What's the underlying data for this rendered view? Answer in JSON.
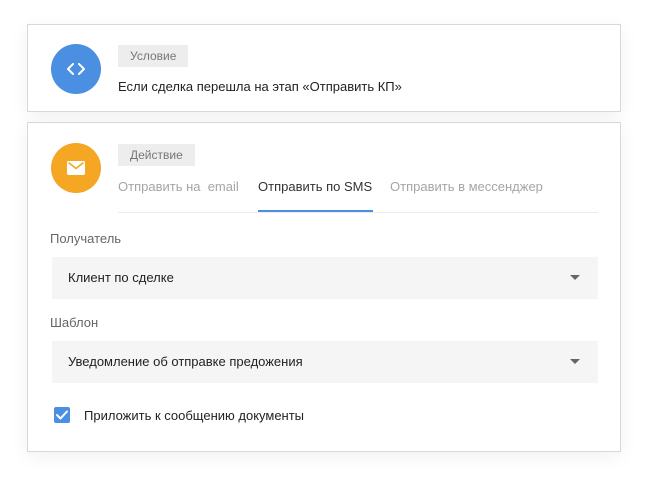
{
  "condition": {
    "icon": "code-icon",
    "icon_color": "#4a8fe2",
    "badge": "Условие",
    "text": "Если сделка перешла на этап «Отправить КП»"
  },
  "action": {
    "icon": "mail-icon",
    "icon_color": "#f5a623",
    "badge": "Действие",
    "tabs": [
      {
        "label": "Отправить на  email",
        "active": false
      },
      {
        "label": "Отправить по SMS",
        "active": true
      },
      {
        "label": "Отправить в мессенджер",
        "active": false
      }
    ],
    "accent_color": "#4a8fe2",
    "recipient": {
      "label": "Получатель",
      "value": "Клиент по сделке"
    },
    "template": {
      "label": "Шаблон",
      "value": "Уведомление об отправке предожения"
    },
    "attach_documents": {
      "label": "Приложить к сообщению документы",
      "checked": true
    }
  }
}
